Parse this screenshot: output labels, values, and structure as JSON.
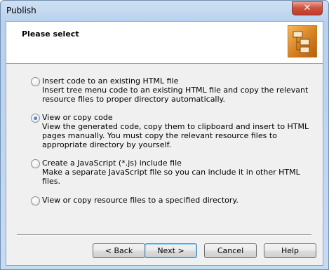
{
  "window": {
    "title": "Publish",
    "close_glyph": "✕"
  },
  "header": {
    "title": "Please select",
    "icon": "tree-menu-icon"
  },
  "options": [
    {
      "label": "Insert code to an existing HTML file",
      "description": "Insert tree menu code to an existing HTML file and copy the relevant resource files to proper directory automatically.",
      "checked": false
    },
    {
      "label": "View or copy code",
      "description": "View the generated code, copy them to clipboard and insert to HTML pages manually. You must copy the relevant resource files to appropriate directory by yourself.",
      "checked": true
    },
    {
      "label": "Create a JavaScript (*.js) include file",
      "description": "Make a separate JavaScript file so you can include it in other HTML files.",
      "checked": false
    },
    {
      "label": "View or copy resource files to a specified directory.",
      "description": "",
      "checked": false
    }
  ],
  "buttons": {
    "back": "< Back",
    "next": "Next >",
    "cancel": "Cancel",
    "help": "Help"
  }
}
